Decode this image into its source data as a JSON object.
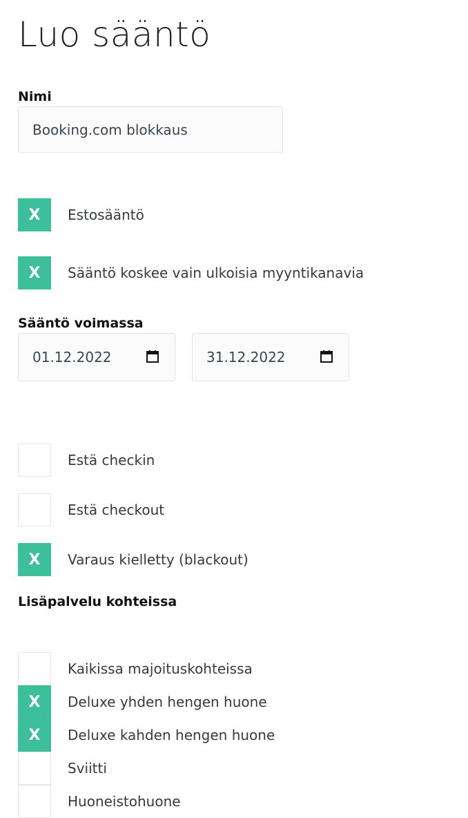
{
  "page_title": "Luo sääntö",
  "name_field": {
    "label": "Nimi",
    "value": "Booking.com blokkaus"
  },
  "options_top": [
    {
      "label": "Estosääntö",
      "checked": true,
      "mark": "X"
    },
    {
      "label": "Sääntö koskee vain ulkoisia myyntikanavia",
      "checked": true,
      "mark": "X"
    }
  ],
  "validity": {
    "label": "Sääntö voimassa",
    "start_date": "01.12.2022",
    "end_date": "31.12.2022"
  },
  "restrictions": [
    {
      "label": "Estä checkin",
      "checked": false,
      "mark": ""
    },
    {
      "label": "Estä checkout",
      "checked": false,
      "mark": ""
    },
    {
      "label": "Varaus kielletty (blackout)",
      "checked": true,
      "mark": "X"
    }
  ],
  "addons": {
    "label": "Lisäpalvelu kohteissa",
    "items": [
      {
        "label": "Kaikissa majoituskohteissa",
        "checked": false,
        "mark": ""
      },
      {
        "label": "Deluxe yhden hengen huone",
        "checked": true,
        "mark": "X"
      },
      {
        "label": "Deluxe kahden hengen huone",
        "checked": true,
        "mark": "X"
      },
      {
        "label": "Sviitti",
        "checked": false,
        "mark": ""
      },
      {
        "label": "Huoneistohuone",
        "checked": false,
        "mark": ""
      }
    ]
  },
  "colors": {
    "checked": "#3ebf9c",
    "checkbox_border": "#e4e6ea",
    "input_bg": "#fbfbfb"
  },
  "icons": {
    "date_picker": "calendar-icon"
  }
}
